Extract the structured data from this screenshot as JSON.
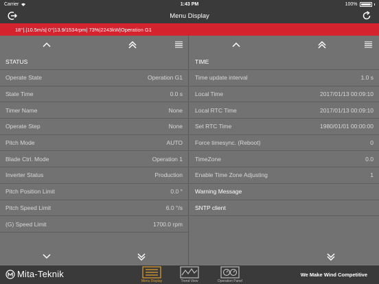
{
  "status_bar": {
    "carrier": "Carrier",
    "time": "1:43 PM",
    "battery": "100%"
  },
  "header": {
    "title": "Menu Display",
    "left_icon": "logout-icon",
    "right_icon": "refresh-icon"
  },
  "info_bar": {
    "text": "18°|.|10.5m/s|  0°|13.9/1534rpm| 73%|2243kW|Operation G1"
  },
  "status_panel": {
    "heading": "STATUS",
    "rows": [
      {
        "label": "Operate State",
        "value": "Operation G1"
      },
      {
        "label": "State Time",
        "value": "0.0 s"
      },
      {
        "label": "Timer Name",
        "value": "None"
      },
      {
        "label": "Operate Step",
        "value": "None"
      },
      {
        "label": "Pitch Mode",
        "value": "AUTO"
      },
      {
        "label": "Blade Ctrl. Mode",
        "value": "Operation 1"
      },
      {
        "label": "Inverter Status",
        "value": "Production"
      },
      {
        "label": "Pitch Position Limit",
        "value": "0.0 °"
      },
      {
        "label": "Pitch Speed Limit",
        "value": "6.0 °/s"
      },
      {
        "label": "(G) Speed Limit",
        "value": "1700.0 rpm"
      }
    ]
  },
  "time_panel": {
    "heading": "TIME",
    "rows": [
      {
        "label": "Time update interval",
        "value": "1.0 s"
      },
      {
        "label": "Local Time",
        "value": "2017/01/13 00:09:10"
      },
      {
        "label": "Local RTC Time",
        "value": "2017/01/13 00:09:10"
      },
      {
        "label": "Set RTC Time",
        "value": "1980/01/01 00:00:00"
      },
      {
        "label": "Force timesync. (Reboot)",
        "value": "0"
      },
      {
        "label": "TimeZone",
        "value": "0.0"
      },
      {
        "label": "Enable Time Zone Adjusting",
        "value": "1"
      },
      {
        "label": "Warning Message",
        "value": ""
      },
      {
        "label": "SNTP client",
        "value": ""
      }
    ]
  },
  "bottom_nav": {
    "logo": "Mita-Teknik",
    "tagline": "We Make Wind Competitive",
    "items": [
      {
        "label": "Menu Display",
        "active": true
      },
      {
        "label": "Trend View",
        "active": false
      },
      {
        "label": "Operation Panel",
        "active": false
      }
    ]
  },
  "colors": {
    "accent_red": "#d4222f",
    "active_orange": "#e0a030",
    "bar_dark": "#3a3a3a"
  }
}
